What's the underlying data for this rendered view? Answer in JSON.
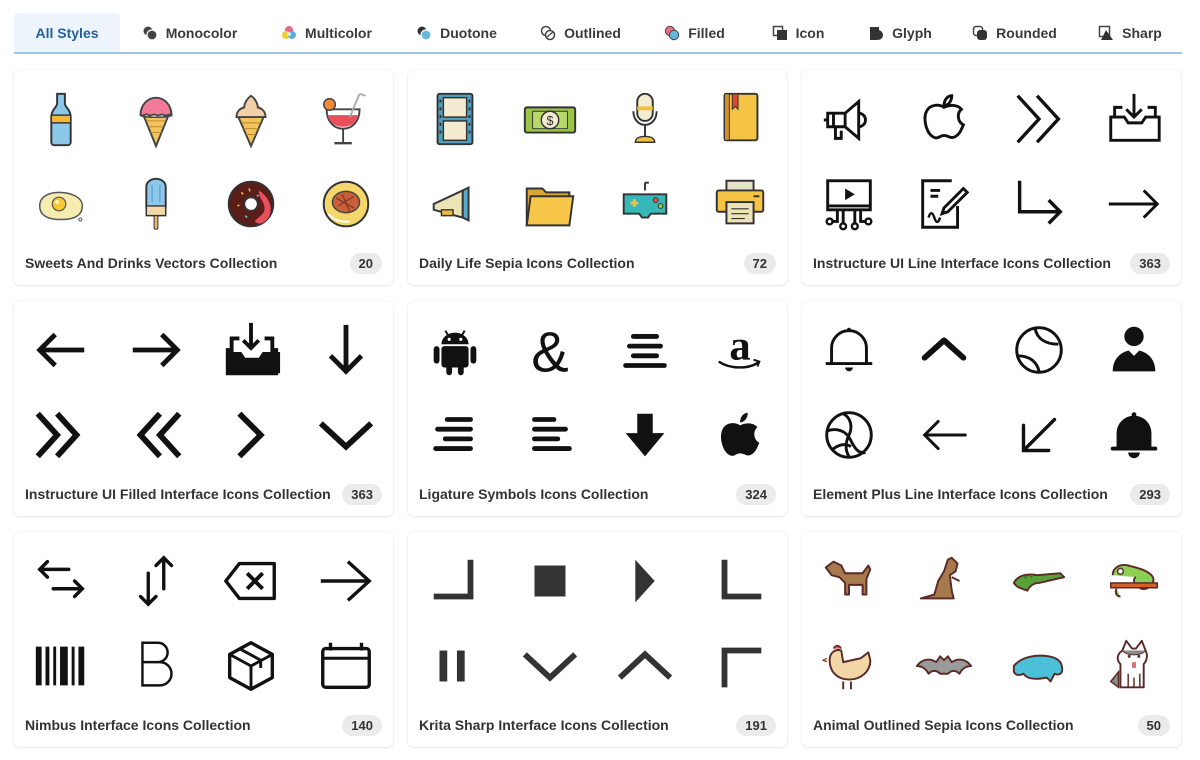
{
  "tabs": [
    {
      "label": "All Styles",
      "icon": "none",
      "active": true
    },
    {
      "label": "Monocolor",
      "icon": "monocolor-icon"
    },
    {
      "label": "Multicolor",
      "icon": "multicolor-icon"
    },
    {
      "label": "Duotone",
      "icon": "duotone-icon"
    },
    {
      "label": "Outlined",
      "icon": "outlined-icon"
    },
    {
      "label": "Filled",
      "icon": "filled-icon"
    },
    {
      "label": "Icon",
      "icon": "icon-style-icon"
    },
    {
      "label": "Glyph",
      "icon": "glyph-icon"
    },
    {
      "label": "Rounded",
      "icon": "rounded-icon"
    },
    {
      "label": "Sharp",
      "icon": "sharp-icon"
    }
  ],
  "collections": [
    {
      "title": "Sweets And Drinks Vectors Collection",
      "count": "20",
      "icons": [
        "soda-bottle",
        "ice-cream-cone-pink",
        "ice-cream-cone-vanilla",
        "cocktail",
        "fried-egg",
        "popsicle",
        "donut",
        "steak-plate"
      ]
    },
    {
      "title": "Daily Life Sepia Icons Collection",
      "count": "72",
      "icons": [
        "film-strip",
        "dollar-bill",
        "microphone",
        "book",
        "megaphone",
        "folder",
        "game-controller",
        "printer"
      ]
    },
    {
      "title": "Instructure UI Line Interface Icons Collection",
      "count": "363",
      "icons": [
        "megaphone",
        "apple",
        "double-chevron-right",
        "inbox-download",
        "video-network",
        "document-sign",
        "arrow-turn-down-right",
        "arrow-right"
      ]
    },
    {
      "title": "Instructure UI Filled Interface Icons Collection",
      "count": "363",
      "icons": [
        "arrow-left",
        "arrow-right",
        "inbox-download",
        "arrow-down",
        "double-chevron-right",
        "double-chevron-left",
        "chevron-right",
        "chevron-down"
      ]
    },
    {
      "title": "Ligature Symbols Icons Collection",
      "count": "324",
      "icons": [
        "android",
        "ampersand",
        "align-center",
        "amazon",
        "align-right",
        "align-left",
        "arrow-down-bold",
        "apple"
      ]
    },
    {
      "title": "Element Plus Line Interface Icons Collection",
      "count": "293",
      "icons": [
        "bell",
        "chevron-up",
        "baseball",
        "user",
        "basketball",
        "arrow-left",
        "arrow-down-left",
        "bell-filled"
      ]
    },
    {
      "title": "Nimbus Interface Icons Collection",
      "count": "140",
      "icons": [
        "arrows-swap-horizontal",
        "arrows-swap-vertical",
        "backspace",
        "arrow-right",
        "barcode",
        "bold",
        "box",
        "calendar"
      ]
    },
    {
      "title": "Krita Sharp Interface Icons Collection",
      "count": "191",
      "icons": [
        "corner-bottom-right",
        "stop",
        "play",
        "corner-bottom-left",
        "pause",
        "chevron-down",
        "chevron-up",
        "corner-top-left"
      ]
    },
    {
      "title": "Animal Outlined Sepia Icons Collection",
      "count": "50",
      "icons": [
        "dog",
        "kangaroo",
        "crocodile",
        "chameleon",
        "chicken",
        "bat",
        "manatee",
        "husky"
      ]
    }
  ]
}
